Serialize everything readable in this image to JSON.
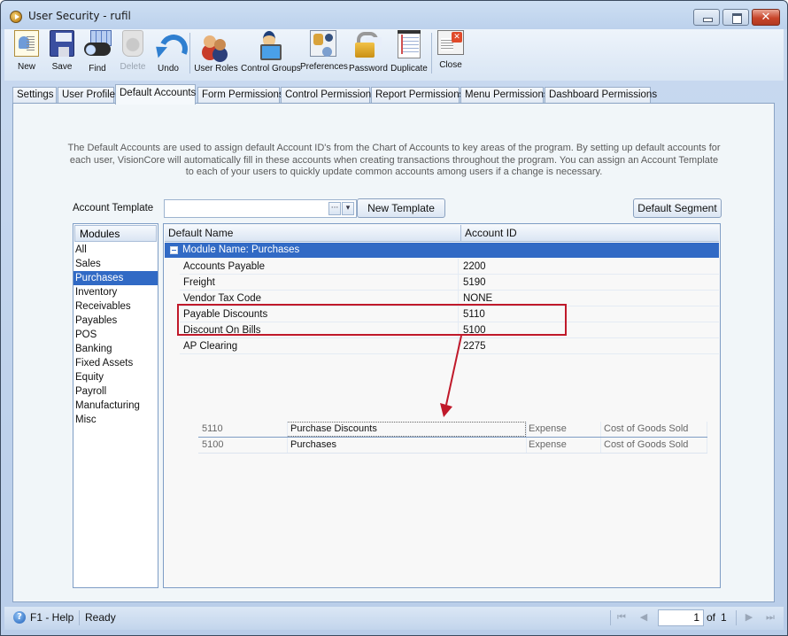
{
  "window": {
    "title": "User Security - rufil",
    "controls": {
      "minimize": "minimize",
      "maximize": "maximize",
      "close": "✕"
    }
  },
  "toolbar": {
    "buttons": [
      {
        "label": "New",
        "icon": "new-user-icon",
        "enabled": true
      },
      {
        "label": "Save",
        "icon": "floppy-disk-icon",
        "enabled": true
      },
      {
        "label": "Find",
        "icon": "binoculars-icon",
        "enabled": true
      },
      {
        "label": "Delete",
        "icon": "recycle-bin-icon",
        "enabled": false
      },
      {
        "label": "Undo",
        "icon": "undo-arrow-icon",
        "enabled": true
      },
      {
        "label": "User Roles",
        "icon": "users-group-icon",
        "enabled": true
      },
      {
        "label": "Control Groups",
        "icon": "user-computer-icon",
        "enabled": true
      },
      {
        "label": "Preferences",
        "icon": "preferences-panel-icon",
        "enabled": true
      },
      {
        "label": "Password",
        "icon": "padlock-key-icon",
        "enabled": true
      },
      {
        "label": "Duplicate",
        "icon": "duplicate-document-icon",
        "enabled": true
      },
      {
        "label": "Close",
        "icon": "close-window-icon",
        "enabled": true
      }
    ]
  },
  "tabs": [
    {
      "label": "Settings",
      "active": false
    },
    {
      "label": "User Profile",
      "active": false
    },
    {
      "label": "Default Accounts",
      "active": true
    },
    {
      "label": "Form Permissions",
      "active": false
    },
    {
      "label": "Control Permissions",
      "active": false
    },
    {
      "label": "Report Permissions",
      "active": false
    },
    {
      "label": "Menu Permissions",
      "active": false
    },
    {
      "label": "Dashboard Permissions",
      "active": false
    }
  ],
  "default_accounts": {
    "description": "The Default Accounts are used to assign default Account ID's from the Chart of Accounts to key areas of the program.  By setting up default accounts for each user, VisionCore will automatically fill in these accounts when creating transactions throughout the program.  You can assign an Account Template to each of your users to quickly update common accounts among users if a change is necessary.",
    "account_template_label": "Account Template",
    "account_template_value": "",
    "ellipsis_button": "···",
    "dropdown_button": "▾",
    "new_template_button": "New Template",
    "default_segment_button": "Default Segment",
    "modules": {
      "header": "Modules",
      "items": [
        "All",
        "Sales",
        "Purchases",
        "Inventory",
        "Receivables",
        "Payables",
        "POS",
        "Banking",
        "Fixed Assets",
        "Equity",
        "Payroll",
        "Manufacturing",
        "Misc"
      ],
      "selected": "Purchases"
    },
    "grid": {
      "columns": [
        "Default Name",
        "Account ID"
      ],
      "group_label": "Module Name: Purchases",
      "rows": [
        {
          "name": "Accounts Payable",
          "account_id": "2200"
        },
        {
          "name": "Freight",
          "account_id": "5190"
        },
        {
          "name": "Vendor Tax Code",
          "account_id": "NONE"
        },
        {
          "name": "Payable Discounts",
          "account_id": "5110"
        },
        {
          "name": "Discount On Bills",
          "account_id": "5100"
        },
        {
          "name": "AP Clearing",
          "account_id": "2275"
        }
      ]
    },
    "annotation": {
      "highlight_color": "#c0192a",
      "highlighted_rows": [
        "Payable Discounts",
        "Discount On Bills"
      ]
    },
    "account_lookup": [
      {
        "account_id": "5110",
        "description": "Purchase Discounts",
        "type": "Expense",
        "group": "Cost of Goods Sold"
      },
      {
        "account_id": "5100",
        "description": "Purchases",
        "type": "Expense",
        "group": "Cost of Goods Sold"
      }
    ]
  },
  "statusbar": {
    "help": "F1 - Help",
    "status": "Ready",
    "page_current": "1",
    "page_of_label": "of",
    "page_total": "1",
    "nav": {
      "first": "⏮",
      "prev": "◀",
      "next": "▶",
      "last": "⏭"
    }
  },
  "colors": {
    "selection": "#316ac5",
    "highlight": "#c0192a"
  }
}
